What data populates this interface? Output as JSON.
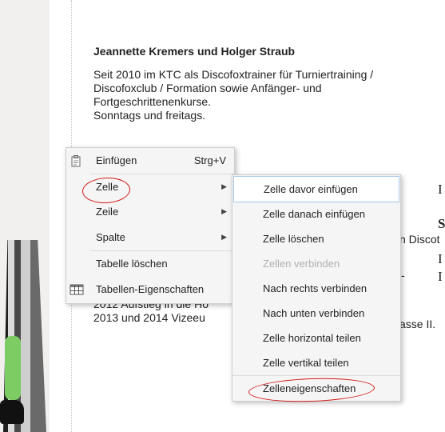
{
  "page": {
    "title": "Jeannette Kremers und Holger Straub",
    "paragraph": [
      "Seit 2010 im KTC als Discofoxtrainer für Turniertraining /",
      "Discofoxclub / Formation sowie Anfänger- und",
      "Fortgeschrittenenkurse.",
      "Sonntags und freitags."
    ],
    "behind": {
      "line1": "2012 Aufstieg in die Ho",
      "line2": "2013 und 2014 Vizeeu",
      "right_discot": "n Discot",
      "right_asse": "asse II.",
      "right_dash": "-",
      "serif_s": "S",
      "serif_i1": "I",
      "serif_i2": "I",
      "serif_i3": "I"
    }
  },
  "context_menu": {
    "items": [
      {
        "label": "Einfügen",
        "shortcut": "Strg+V",
        "icon": "clipboard-icon"
      },
      {
        "label": "Zelle",
        "submenu": true
      },
      {
        "label": "Zeile",
        "submenu": true
      },
      {
        "label": "Spalte",
        "submenu": true
      },
      {
        "label": "Tabelle löschen"
      },
      {
        "label": "Tabellen-Eigenschaften",
        "icon": "table-icon"
      }
    ]
  },
  "submenu": {
    "items": [
      {
        "label": "Zelle davor einfügen",
        "highlighted": true
      },
      {
        "label": "Zelle danach einfügen"
      },
      {
        "label": "Zelle löschen"
      },
      {
        "label": "Zellen verbinden",
        "disabled": true
      },
      {
        "label": "Nach rechts verbinden"
      },
      {
        "label": "Nach unten verbinden"
      },
      {
        "label": "Zelle horizontal teilen"
      },
      {
        "label": "Zelle vertikal teilen"
      },
      {
        "label": "Zelleneigenschaften"
      }
    ]
  },
  "colors": {
    "annotation": "#d01818",
    "highlight_border": "#aac8ea",
    "menu_bg": "#f5f5f5"
  }
}
